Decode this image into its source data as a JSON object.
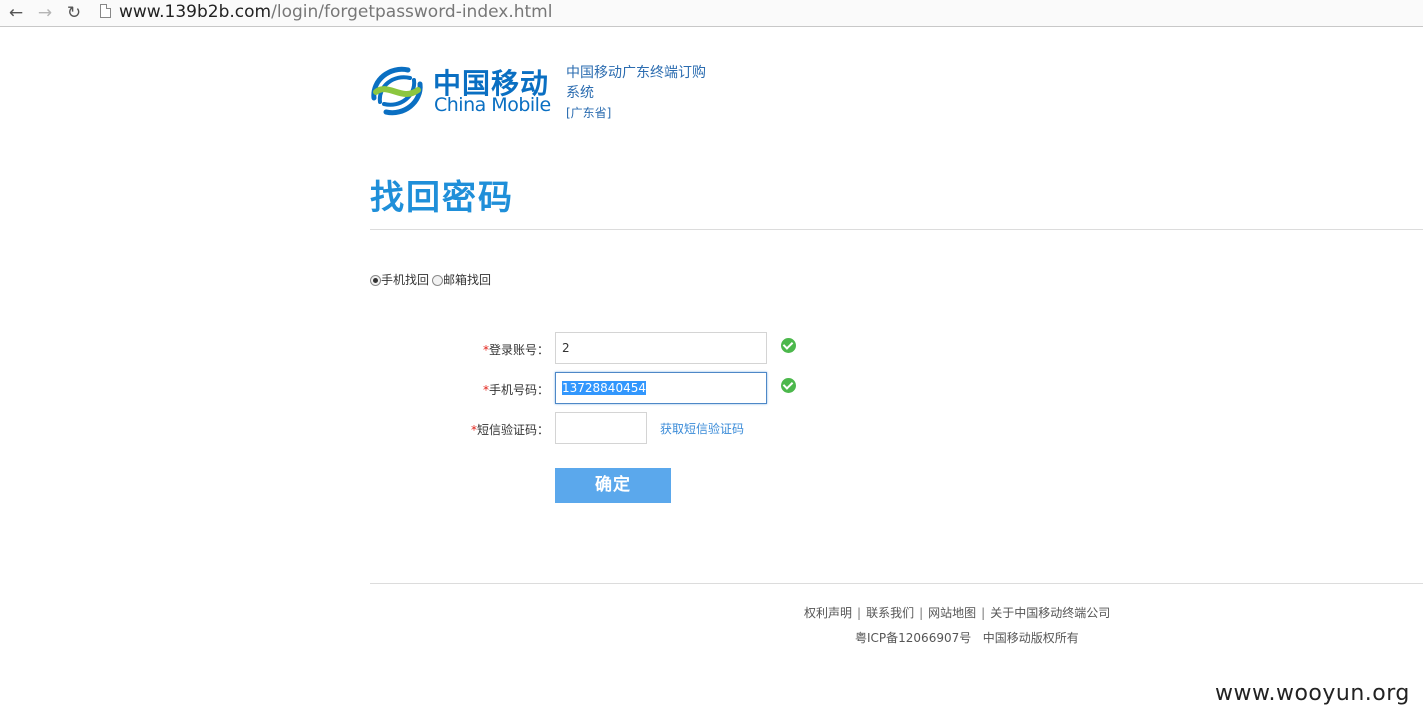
{
  "browser": {
    "url_host": "www.139b2b.com",
    "url_path": "/login/forgetpassword-index.html",
    "icons": {
      "back": "back-arrow-icon",
      "forward": "forward-arrow-icon",
      "reload": "reload-icon",
      "page": "page-icon"
    }
  },
  "header": {
    "logo_cn": "中国移动",
    "logo_en": "China Mobile",
    "system_title": "中国移动广东终端订购系统",
    "province": "[广东省]",
    "colors": {
      "brand_blue": "#0a6fc2",
      "brand_green": "#8cc63f"
    }
  },
  "page": {
    "title": "找回密码",
    "title_color": "#1f8fd9"
  },
  "recovery_method": {
    "options": [
      {
        "label": "手机找回",
        "checked": true
      },
      {
        "label": "邮箱找回",
        "checked": false
      }
    ]
  },
  "form": {
    "account": {
      "required_mark": "*",
      "label": "登录账号：",
      "value": "2",
      "valid": true
    },
    "phone": {
      "required_mark": "*",
      "label": "手机号码：",
      "value": "13728840454",
      "valid": true,
      "selected": true
    },
    "sms_code": {
      "required_mark": "*",
      "label": "短信验证码：",
      "value": ""
    },
    "sms_link": "获取短信验证码",
    "submit_label": "确定",
    "valid_icon": "check-circle-icon"
  },
  "footer": {
    "links": [
      "权利声明",
      "联系我们",
      "网站地图",
      "关于中国移动终端公司"
    ],
    "separator": "|",
    "icp": "粤ICP备12066907号",
    "copyright": "中国移动版权所有"
  },
  "watermark": "www.wooyun.org"
}
